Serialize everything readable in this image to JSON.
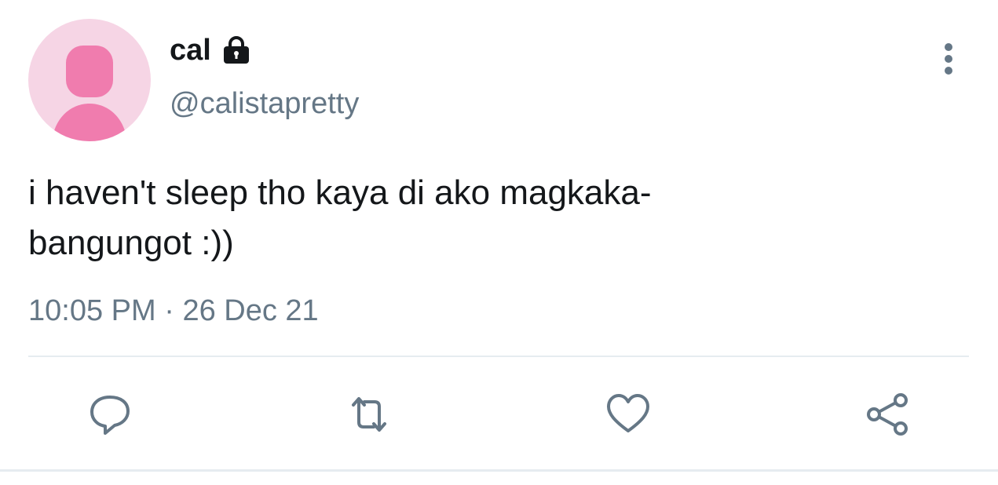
{
  "user": {
    "display_name": "cal",
    "handle": "@calistapretty",
    "protected": true,
    "avatar_bg_color": "#f6d5e5",
    "avatar_fg_color": "#f07cae"
  },
  "tweet": {
    "text": "i haven't sleep tho kaya di ako magkaka-\nbangungot :))",
    "time": "10:05 PM",
    "separator": " · ",
    "date": "26 Dec 21"
  },
  "icons": {
    "lock": "lock-icon",
    "more": "more-vertical-icon",
    "reply": "reply-icon",
    "retweet": "retweet-icon",
    "like": "heart-icon",
    "share": "share-icon"
  },
  "colors": {
    "text_primary": "#14171a",
    "text_secondary": "#657786",
    "icon": "#657786",
    "divider": "#e6ecf0"
  }
}
